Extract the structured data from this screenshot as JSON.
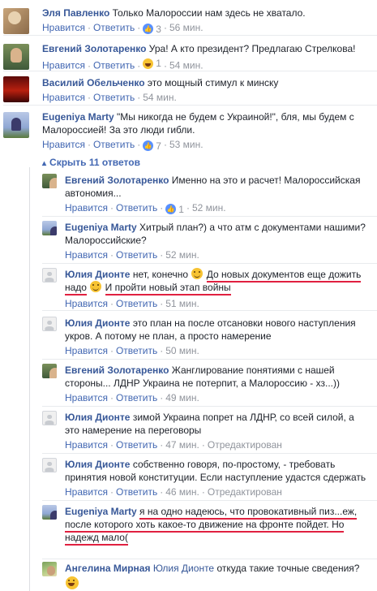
{
  "top_comments": [
    {
      "author": "Эля Павленко",
      "text": "Только Малороссии нам здесь не хватало.",
      "like": "Нравится",
      "reply": "Ответить",
      "likes": "3",
      "reaction": "like",
      "time": "56 мин."
    },
    {
      "author": "Евгений Золотаренко",
      "text": "Ура! А кто президент? Предлагаю Стрелкова!",
      "like": "Нравится",
      "reply": "Ответить",
      "likes": "1",
      "reaction": "haha",
      "time": "54 мин."
    },
    {
      "author": "Василий Обельченко",
      "text": "это мощный стимул к минску",
      "like": "Нравится",
      "reply": "Ответить",
      "time": "54 мин."
    },
    {
      "author": "Eugeniya Marty",
      "text": "\"Мы никогда не будем с Украиной!\", бля, мы будем с Малороссией! За это люди гибли.",
      "like": "Нравится",
      "reply": "Ответить",
      "likes": "7",
      "reaction": "like",
      "time": "53 мин."
    }
  ],
  "replies_toggle": "Скрыть 11 ответов",
  "replies": [
    {
      "author": "Евгений Золотаренко",
      "text": "Именно на это и расчет! Малороссийская автономия...",
      "like": "Нравится",
      "reply": "Ответить",
      "likes": "1",
      "reaction": "like",
      "time": "52 мин."
    },
    {
      "author": "Eugeniya Marty",
      "text": "Хитрый план?) а что атм с документами нашими? Малороссийские?",
      "like": "Нравится",
      "reply": "Ответить",
      "time": "52 мин."
    },
    {
      "author": "Юлия Дионте",
      "text_a": "нет, конечно",
      "text_b": "До новых документов еще дожить надо",
      "text_c": "И пройти новый этап войны",
      "like": "Нравится",
      "reply": "Ответить",
      "time": "51 мин."
    },
    {
      "author": "Юлия Дионте",
      "text": "это план на после отсановки нового наступления укров. А потому не план, а просто намерение",
      "like": "Нравится",
      "reply": "Ответить",
      "time": "50 мин."
    },
    {
      "author": "Евгений Золотаренко",
      "text": "Жанглирование понятиями с нашей стороны... ЛДНР Украина не потерпит, а Малороссию - хз...))",
      "like": "Нравится",
      "reply": "Ответить",
      "time": "49 мин."
    },
    {
      "author": "Юлия Дионте",
      "text": "зимой Украина попрет на ЛДНР, со всей силой, а это намерение на переговоры",
      "like": "Нравится",
      "reply": "Ответить",
      "time": "47 мин.",
      "edited": "Отредактирован"
    },
    {
      "author": "Юлия Дионте",
      "text": "собственно говоря, по-простому, - требовать принятия новой конституции. Если наступление удастся сдержать",
      "like": "Нравится",
      "reply": "Ответить",
      "time": "46 мин.",
      "edited": "Отредактирован"
    },
    {
      "author": "Eugeniya Marty",
      "text": "я на одно надеюсь, что провокативный пиз...еж, после которого хоть какое-то движение на фронте пойдет. Но надежд мало(",
      "like": "Нравится",
      "reply": "Ответить"
    },
    {
      "author": "Ангелина Мирная",
      "mention": "Юлия Дионте",
      "text": "откуда такие точные сведения?"
    }
  ],
  "sep": "·",
  "colors": {
    "link": "#385898",
    "action": "#4267b2",
    "meta": "#90949c",
    "underline": "#e02040"
  }
}
